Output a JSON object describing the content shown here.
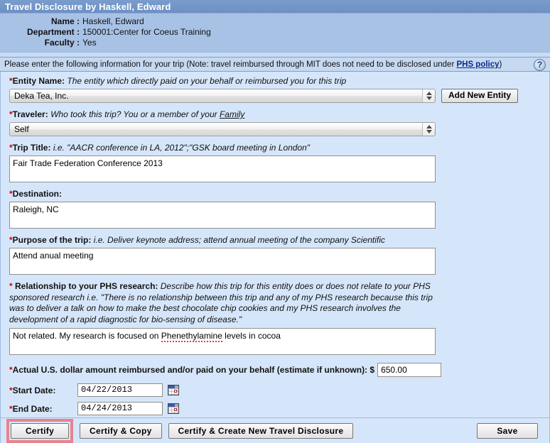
{
  "header": {
    "title": "Travel Disclosure by Haskell, Edward",
    "info_rows": [
      {
        "label": "Name :",
        "value": "Haskell, Edward"
      },
      {
        "label": "Department :",
        "value": "150001:Center for Coeus Training"
      },
      {
        "label": "Faculty :",
        "value": "Yes"
      }
    ]
  },
  "instruction": {
    "text_before": "Please enter the following information for your trip (Note: travel reimbursed through MIT does not need to be disclosed under ",
    "link_label": "PHS policy",
    "text_after": ")",
    "help_icon": "question-mark-circle-icon",
    "help_glyph": "?"
  },
  "fields": {
    "entity": {
      "label": "Entity Name:",
      "hint": "The entity which directly paid on your behalf or reimbursed you for this trip",
      "value": "Deka Tea, Inc.",
      "add_button": "Add New Entity"
    },
    "traveler": {
      "label": "Traveler:",
      "hint_before": "Who took this trip? You or a member of your ",
      "hint_link": "Family",
      "value": "Self"
    },
    "trip_title": {
      "label": "Trip Title:",
      "hint": "i.e. \"AACR conference in LA, 2012\";\"GSK board meeting in London\"",
      "value": "Fair Trade Federation Conference 2013"
    },
    "destination": {
      "label": "Destination:",
      "value": "Raleigh, NC"
    },
    "purpose": {
      "label": "Purpose of the trip:",
      "hint": "i.e. Deliver keynote address; attend annual meeting of the company Scientific",
      "value": "Attend anual meeting"
    },
    "relationship": {
      "label": "Relationship to your PHS research:",
      "hint": "Describe how this trip for this entity does or does not relate to your PHS sponsored research i.e. \"There is no relationship between this trip and any of my PHS research because this trip was to deliver a talk on how to make the best chocolate chip cookies and my PHS research involves the development of a rapid diagnostic for bio-sensing of disease.\"",
      "value_before": "Not related. My research is focused on ",
      "value_misspelled": "Phenethylamine",
      "value_after": " levels in cocoa"
    },
    "amount": {
      "label": "Actual U.S. dollar amount reimbursed and/or paid on your behalf (estimate if unknown): $",
      "value": "650.00"
    },
    "start_date": {
      "label": "Start Date:",
      "value": "04/22/2013",
      "calendar_icon": "calendar-icon"
    },
    "end_date": {
      "label": "End Date:",
      "value": "04/24/2013",
      "calendar_icon": "calendar-icon"
    }
  },
  "buttons": {
    "certify": "Certify",
    "certify_copy": "Certify & Copy",
    "certify_create": "Certify & Create  New Travel Disclosure",
    "save": "Save"
  },
  "colors": {
    "title_bar": "#7196c9",
    "header_info_bg": "#a8c2e6",
    "instruction_bg": "#c6d9f1",
    "form_bg": "#d6e6fa",
    "required_asterisk": "#d00000",
    "link": "#0b2a8a",
    "highlight_box": "#e8838c",
    "spellcheck_underline": "#e03a3a"
  }
}
